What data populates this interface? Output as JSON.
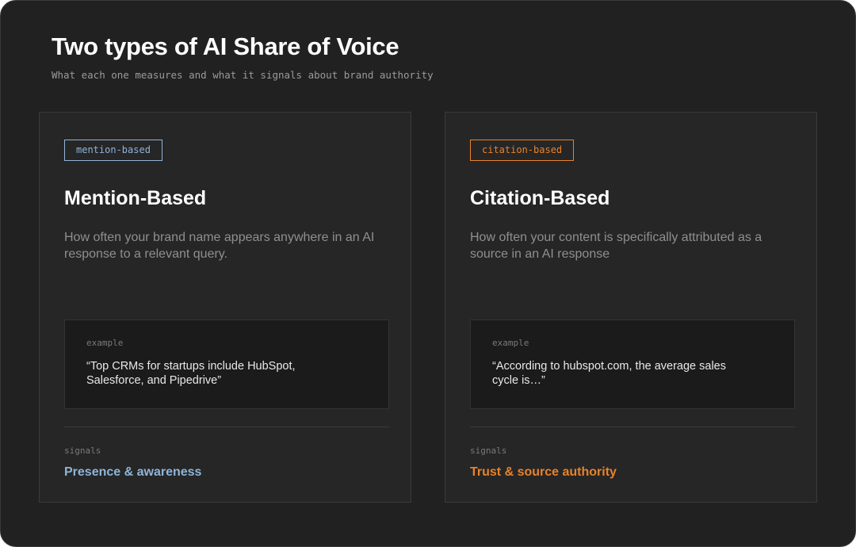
{
  "header": {
    "title": "Two types of AI Share of Voice",
    "subtitle": "What each one measures and what it signals about brand authority"
  },
  "colors": {
    "background": "#212121",
    "card": "#262626",
    "mention_accent": "#8fb4d8",
    "citation_accent": "#e8822a"
  },
  "cards": [
    {
      "tag": "mention-based",
      "title": "Mention-Based",
      "description": "How often your brand name appears anywhere in an AI response to a relevant query.",
      "example_label": "example",
      "example_quote": "“Top CRMs for startups include HubSpot, Salesforce, and Pipedrive”",
      "signals_label": "signals",
      "signals_value": "Presence & awareness"
    },
    {
      "tag": "citation-based",
      "title": "Citation-Based",
      "description": "How often your content is specifically attributed as a source in an AI response",
      "example_label": "example",
      "example_quote": "“According to hubspot.com, the average sales cycle is…”",
      "signals_label": "signals",
      "signals_value": "Trust & source authority"
    }
  ]
}
